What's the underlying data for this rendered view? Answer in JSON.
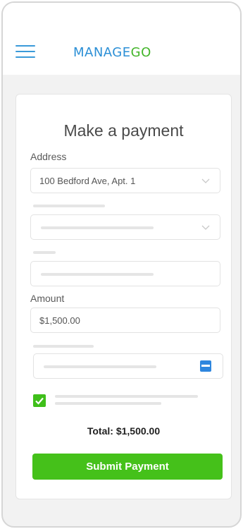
{
  "header": {
    "logo_part1": "MANAGE",
    "logo_part2": "GO",
    "menu_icon": "hamburger-icon"
  },
  "payment_form": {
    "title": "Make a payment",
    "address": {
      "label": "Address",
      "value": "100 Bedford Ave, Apt. 1",
      "icon": "chevron-down-icon"
    },
    "amount": {
      "label": "Amount",
      "value": "$1,500.00"
    },
    "date_field": {
      "icon": "calendar-icon"
    },
    "agree_checkbox": {
      "checked": true,
      "icon": "checkmark-icon"
    },
    "total_label": "Total:",
    "total_value": "$1,500.00",
    "submit_label": "Submit Payment"
  },
  "colors": {
    "brand_blue": "#2b8fd6",
    "brand_green": "#43b52a",
    "button_green": "#45c11a",
    "calendar_blue": "#2e86de"
  }
}
